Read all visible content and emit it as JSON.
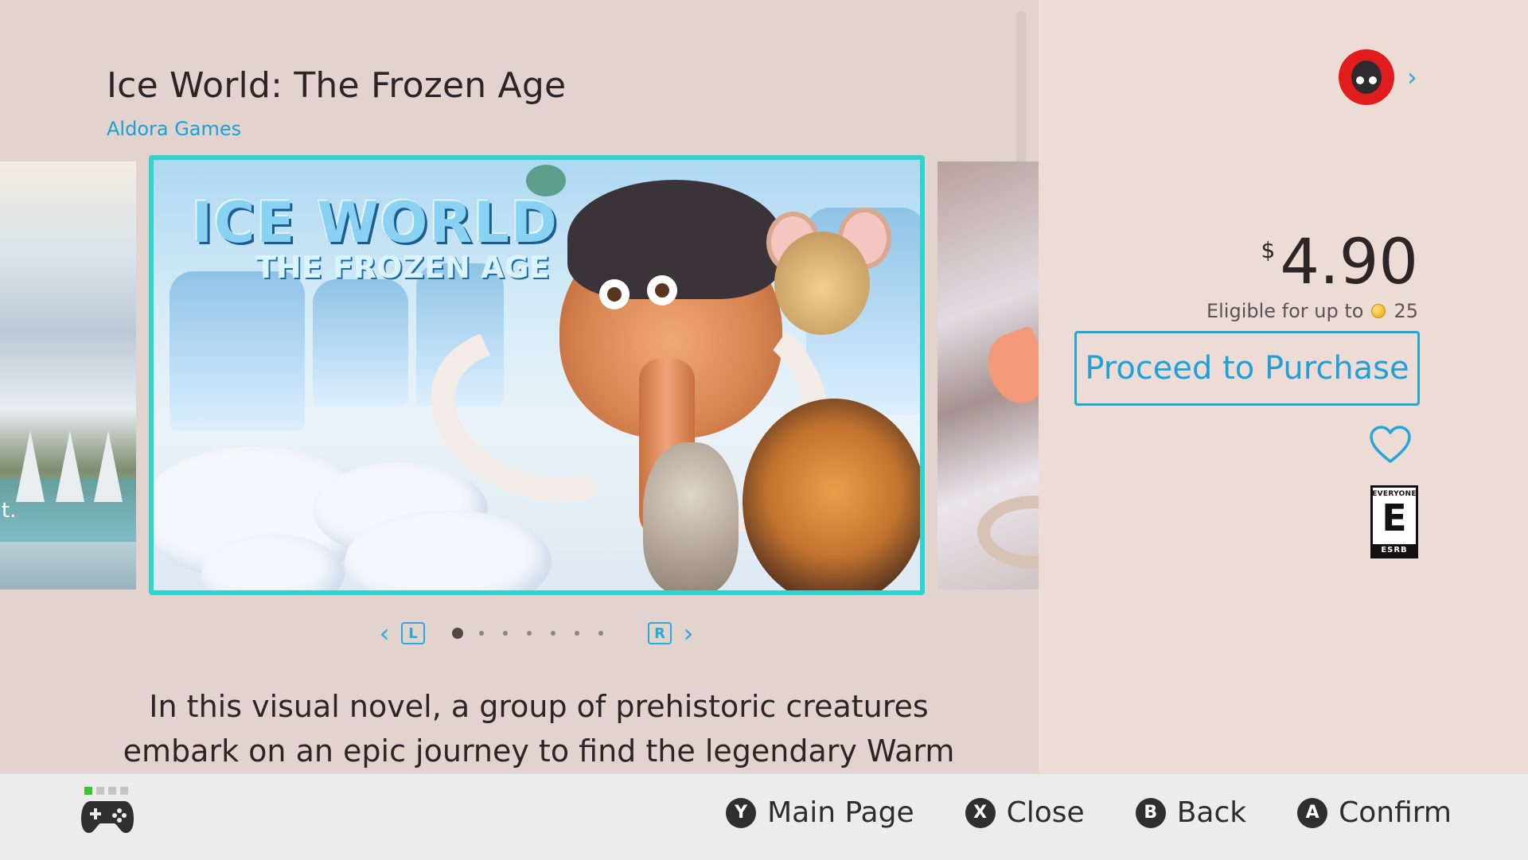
{
  "game": {
    "title": "Ice World: The Frozen Age",
    "publisher": "Aldora Games",
    "description": "In this visual novel, a group of prehistoric creatures embark on an epic journey to find the legendary Warm Valley.",
    "hero_logo": {
      "line1": "ICE WORLD",
      "line2": "THE FROZEN AGE"
    },
    "left_thumb_fragment": "t."
  },
  "carousel": {
    "prev_chevron": "‹",
    "next_chevron": "›",
    "left_shoulder": "L",
    "right_shoulder": "R",
    "page_count": 7,
    "active_page": 1
  },
  "purchase": {
    "currency": "$",
    "price": "4.90",
    "points_prefix": "Eligible for up to",
    "points_value": "25",
    "button_label": "Proceed to Purchase"
  },
  "rating": {
    "top": "EVERYONE",
    "letter": "E",
    "bottom": "ESRB"
  },
  "account": {
    "arrow": "›"
  },
  "icons": {
    "avatar": "user-avatar-icon",
    "account_arrow": "chevron-right-icon",
    "wishlist": "heart-icon",
    "controller": "gamepad-icon",
    "gold_points": "coin-icon"
  },
  "colors": {
    "accent": "#23a6d8",
    "hero_border": "#2fd3cf",
    "avatar_bg": "#e11c1c",
    "player_indicator": "#38c72b"
  },
  "bottom_bar": {
    "hints": [
      {
        "key": "Y",
        "label": "Main Page"
      },
      {
        "key": "X",
        "label": "Close"
      },
      {
        "key": "B",
        "label": "Back"
      },
      {
        "key": "A",
        "label": "Confirm"
      }
    ]
  }
}
